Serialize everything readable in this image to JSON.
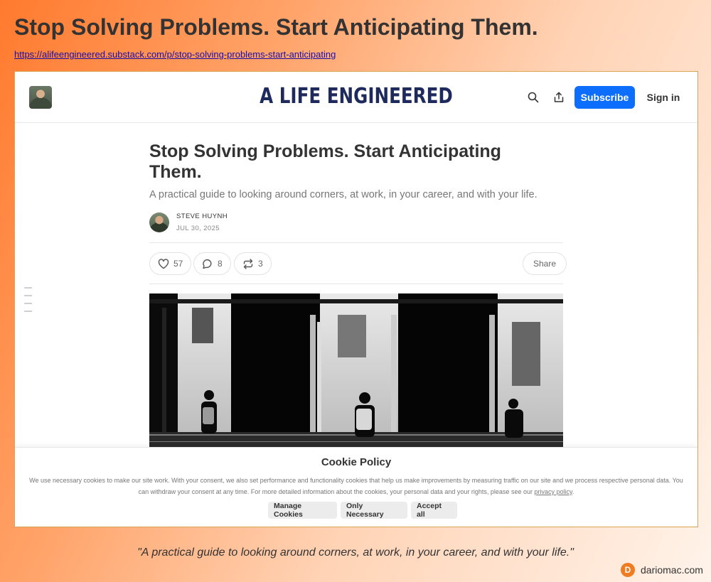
{
  "page": {
    "title": "Stop Solving Problems. Start Anticipating Them.",
    "url": "https://alifeengineered.substack.com/p/stop-solving-problems-start-anticipating"
  },
  "site": {
    "name": "A LIFE ENGINEERED",
    "subscribe_label": "Subscribe",
    "signin_label": "Sign in",
    "icons": [
      "search-icon",
      "share-icon"
    ]
  },
  "article": {
    "title": "Stop Solving Problems. Start Anticipating Them.",
    "subtitle": "A practical guide to looking around corners, at work, in your career, and with your life.",
    "author": "STEVE HUYNH",
    "date": "JUL 30, 2025",
    "likes": "57",
    "comments": "8",
    "restacks": "3",
    "share_label": "Share"
  },
  "cookie": {
    "title": "Cookie Policy",
    "text": "We use necessary cookies to make our site work. With your consent, we also set performance and functionality cookies that help us make improvements by measuring traffic on our site and we process respective personal data. You can withdraw your consent at any time. For more detailed information about the cookies, your personal data and your rights, please see our ",
    "link_label": "privacy policy",
    "text_end": ".",
    "manage_label": "Manage Cookies",
    "necessary_label": "Only Necessary",
    "accept_label": "Accept all"
  },
  "caption": {
    "quote": "\"A practical guide to looking around corners, at work, in your career, and with your life.\"",
    "brand_initial": "D",
    "brand_name": "dariomac.com"
  },
  "colors": {
    "accent": "#0d6efd",
    "brand_badge": "#f07c22",
    "site_name": "#1f2a5c"
  }
}
